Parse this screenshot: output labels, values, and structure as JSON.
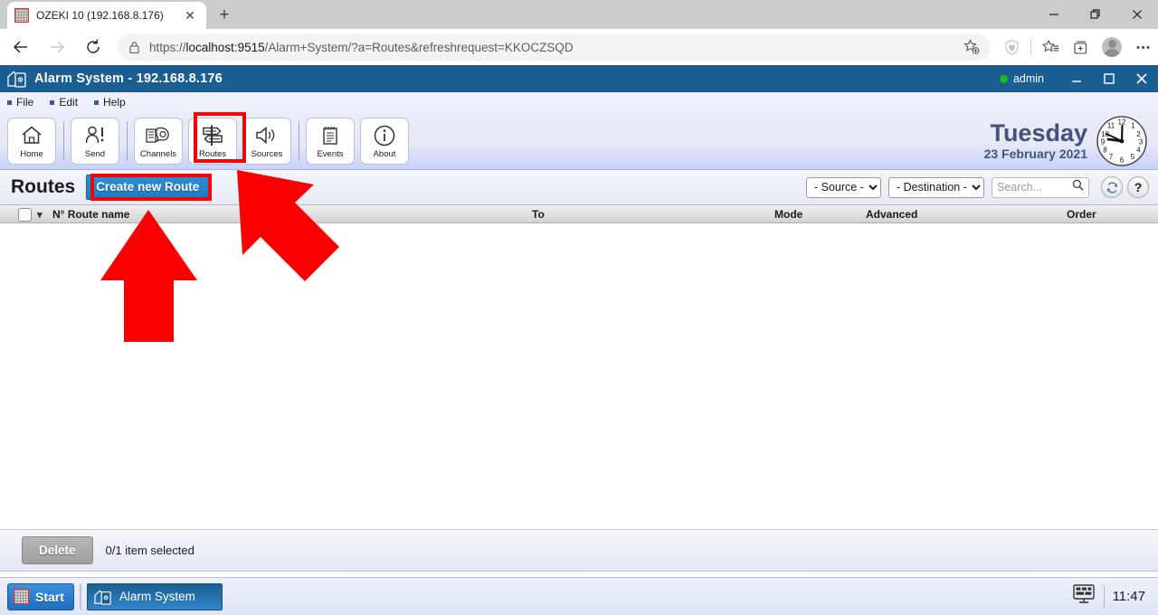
{
  "browser": {
    "tab": {
      "title": "OZEKI 10 (192.168.8.176)",
      "favicon": "ozeki-favicon",
      "close": "✕"
    },
    "new_tab": "+",
    "window_controls": {
      "minimize": "—",
      "maximize": "❐",
      "close": "✕"
    },
    "nav": {
      "back": "←",
      "forward": "→",
      "reload": "↻"
    },
    "address": {
      "url_prefix": "https://",
      "url_host": "localhost:9515",
      "url_path": "/Alarm+System/?a=Routes&refreshrequest=KKOCZSQD",
      "full_url": "https://localhost:9515/Alarm+System/?a=Routes&refreshrequest=KKOCZSQD"
    }
  },
  "app": {
    "title": "Alarm System - 192.168.8.176",
    "user": "admin",
    "window_controls": {
      "minimize": "–",
      "maximize": "❐",
      "close": "✕"
    },
    "menu": [
      {
        "label": "File"
      },
      {
        "label": "Edit"
      },
      {
        "label": "Help"
      }
    ],
    "toolbar": [
      {
        "label": "Home",
        "icon": "home-icon"
      },
      {
        "label": "Send",
        "icon": "send-person-icon"
      },
      {
        "label": "Channels",
        "icon": "channels-icon"
      },
      {
        "label": "Routes",
        "icon": "routes-signpost-icon",
        "selected": true
      },
      {
        "label": "Sources",
        "icon": "speaker-icon"
      },
      {
        "label": "Events",
        "icon": "notepad-icon"
      },
      {
        "label": "About",
        "icon": "info-icon"
      }
    ],
    "clock": {
      "dayname": "Tuesday",
      "date": "23 February 2021",
      "numerals": [
        "12",
        "1",
        "2",
        "3",
        "4",
        "5",
        "6",
        "7",
        "8",
        "9",
        "10",
        "11"
      ],
      "time": "11:47"
    }
  },
  "page": {
    "title": "Routes",
    "create_button": "Create new Route",
    "filters": {
      "source": {
        "selected": "- Source -",
        "options": [
          "- Source -"
        ]
      },
      "destination": {
        "selected": "- Destination -",
        "options": [
          "- Destination -"
        ]
      }
    },
    "search": {
      "value": "",
      "placeholder": "Search...",
      "icon": "magnifier-icon"
    },
    "refresh_icon": "refresh-icon",
    "help_icon": "question-mark-icon",
    "table": {
      "select_all_checked": false,
      "columns": [
        "N° Route name",
        "To",
        "Mode",
        "Advanced",
        "Order"
      ],
      "rows": []
    },
    "footer": {
      "delete_button": "Delete",
      "selection_status": "0/1 item selected"
    }
  },
  "taskbar": {
    "start": "Start",
    "tasks": [
      {
        "label": "Alarm System",
        "icon": "alarm-system-icon"
      }
    ],
    "tray_icon": "display-icon",
    "clock": "11:47"
  },
  "annotations": {
    "arrow_up": {
      "target": "create-new-route-button",
      "color": "#fb0000"
    },
    "arrow_diagonal": {
      "target": "routes-toolbar-button",
      "color": "#fb0000"
    },
    "highlight_color": "#fb0000"
  }
}
